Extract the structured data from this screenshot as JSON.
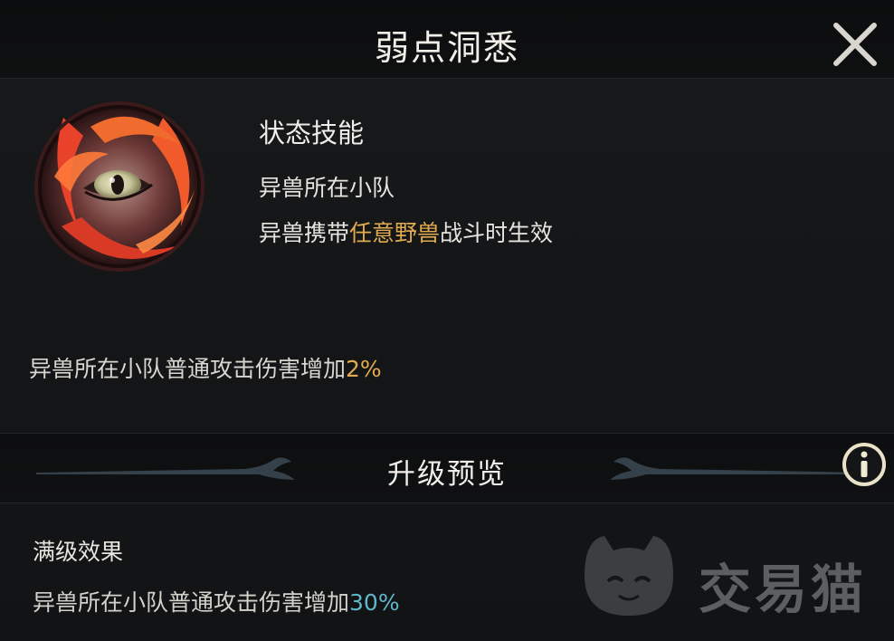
{
  "header": {
    "title": "弱点洞悉"
  },
  "icons": {
    "close": "close-icon",
    "skill": "tiger-eye-skill-icon",
    "info": "info-icon",
    "watermark": "jiaoyimao-cat-logo"
  },
  "skill": {
    "type": "状态技能",
    "scope": "异兽所在小队",
    "condition_prefix": "异兽携带",
    "condition_highlight": "任意野兽",
    "condition_suffix": "战斗时生效",
    "current_effect_prefix": "异兽所在小队普通攻击伤害增加",
    "current_effect_value": "2%"
  },
  "upgrade": {
    "section_title": "升级预览",
    "max_label": "满级效果",
    "max_effect_prefix": "异兽所在小队普通攻击伤害增加",
    "max_effect_value": "30%"
  },
  "watermark": {
    "text": "交易猫"
  },
  "colors": {
    "highlight_gold": "#e1ab4f",
    "highlight_teal": "#5fb8c9",
    "background": "#121416"
  }
}
